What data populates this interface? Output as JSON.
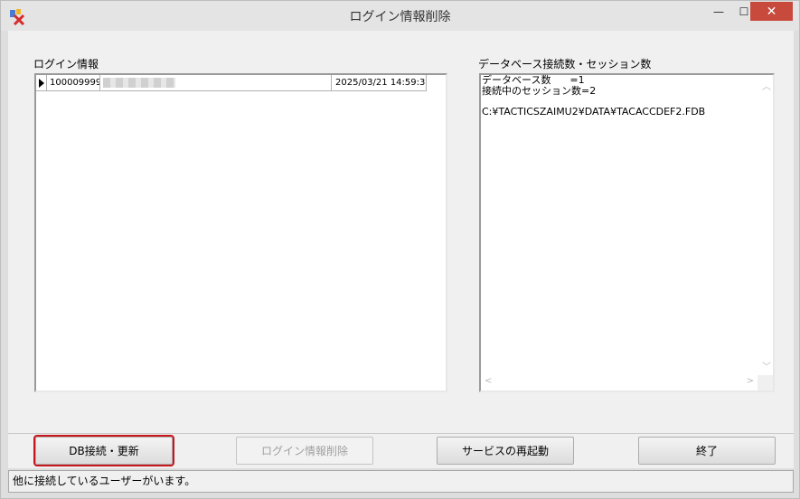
{
  "window": {
    "title": "ログイン情報削除",
    "minimize_glyph": "—",
    "maximize_glyph": "☐",
    "close_glyph": "✕"
  },
  "login_panel": {
    "label": "ログイン情報",
    "rows": [
      {
        "id": "100009999",
        "name": "",
        "date": "2025/03/21 14:59:3"
      }
    ]
  },
  "db_panel": {
    "label": "データベース接続数・セッション数",
    "text": "データベース数      =1\n接続中のセッション数=2\n\nC:¥TACTICSZAIMU2¥DATA¥TACACCDEF2.FDB"
  },
  "buttons": {
    "db_connect_refresh": "DB接続・更新",
    "delete_login": "ログイン情報削除",
    "restart_service": "サービスの再起動",
    "exit": "終了"
  },
  "status": {
    "message": "他に接続しているユーザーがいます。"
  },
  "colors": {
    "highlight": "#c8161d",
    "close_button": "#c74a3c"
  }
}
